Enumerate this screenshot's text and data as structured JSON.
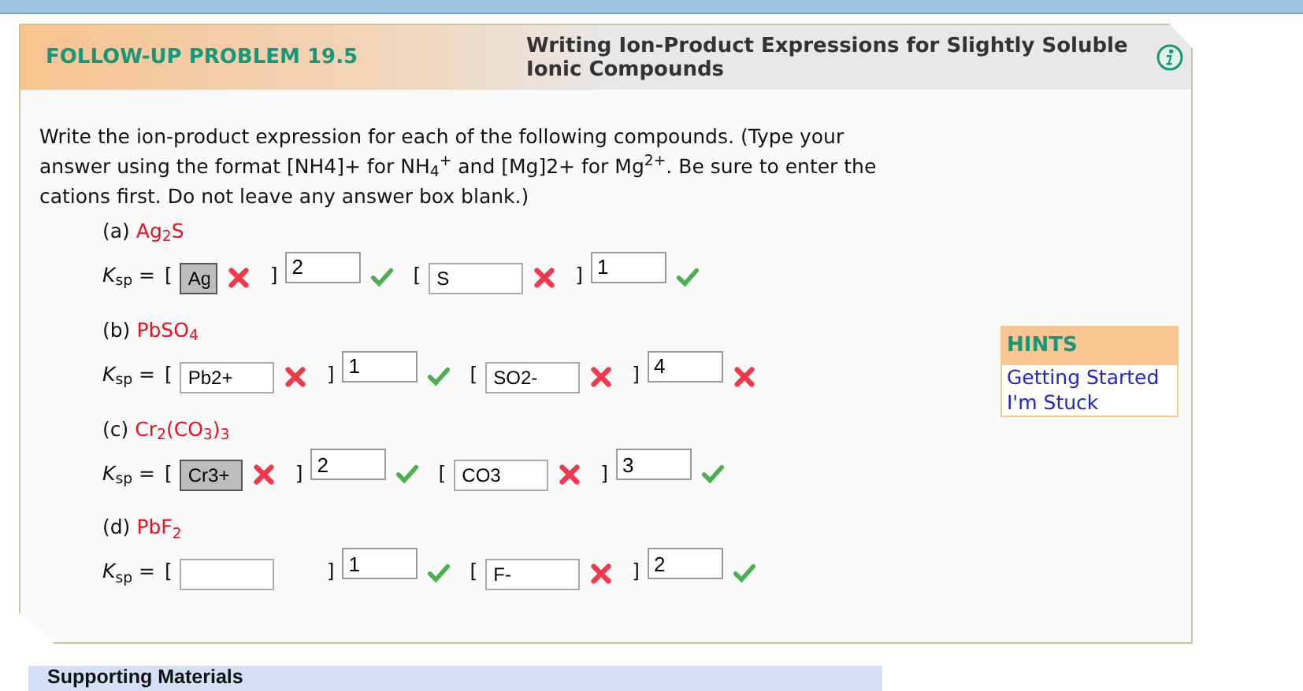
{
  "header": {
    "label": "FOLLOW-UP PROBLEM 19.5",
    "title": "Writing Ion-Product Expressions for Slightly Soluble Ionic Compounds"
  },
  "instructions": "Write the ion-product expression for each of the following compounds. (Type your answer using the format [NH4]+ for NH$_{4}$$^{+}$ and [Mg]2+ for Mg$^{2+}$. Be sure to enter the cations first. Do not leave any answer box blank.)",
  "problems": [
    {
      "letter": "(a)",
      "formula": "Ag$_{2}$S",
      "ksp": "*K*$_{sp}$ =",
      "terms": [
        {
          "open": "[",
          "ion": {
            "value": "Ag",
            "highlighted": true,
            "correct": false
          },
          "close": "]",
          "exponent": {
            "value": "2",
            "correct": true
          }
        },
        {
          "open": "[",
          "ion": {
            "value": "S",
            "highlighted": false,
            "correct": false
          },
          "close": "]",
          "exponent": {
            "value": "1",
            "correct": true
          }
        }
      ]
    },
    {
      "letter": "(b)",
      "formula": "PbSO$_{4}$",
      "ksp": "*K*$_{sp}$ =",
      "terms": [
        {
          "open": "[",
          "ion": {
            "value": "Pb2+",
            "highlighted": false,
            "correct": false
          },
          "close": "]",
          "exponent": {
            "value": "1",
            "correct": true
          }
        },
        {
          "open": "[",
          "ion": {
            "value": "SO2-",
            "highlighted": false,
            "correct": false
          },
          "close": "]",
          "exponent": {
            "value": "4",
            "correct": false
          }
        }
      ]
    },
    {
      "letter": "(c)",
      "formula": "Cr$_{2}$(CO$_{3}$)$_{3}$",
      "ksp": "*K*$_{sp}$ =",
      "terms": [
        {
          "open": "[",
          "ion": {
            "value": "Cr3+",
            "highlighted": true,
            "correct": false
          },
          "close": "]",
          "exponent": {
            "value": "2",
            "correct": true
          }
        },
        {
          "open": "[",
          "ion": {
            "value": "CO3",
            "highlighted": false,
            "correct": false
          },
          "close": "]",
          "exponent": {
            "value": "3",
            "correct": true
          }
        }
      ]
    },
    {
      "letter": "(d)",
      "formula": "PbF$_{2}$",
      "ksp": "*K*$_{sp}$ =",
      "terms": [
        {
          "open": "[",
          "ion": {
            "highlighted": false
          },
          "close": "]",
          "exponent": {
            "value": "1",
            "correct": true
          }
        },
        {
          "open": "[",
          "ion": {
            "value": "F-",
            "highlighted": false,
            "correct": false
          },
          "close": "]",
          "exponent": {
            "value": "2",
            "correct": true
          }
        }
      ]
    }
  ],
  "hints": {
    "title": "HINTS",
    "links": [
      "Getting Started",
      "I'm Stuck"
    ]
  },
  "supporting": {
    "title": "Supporting Materials"
  }
}
